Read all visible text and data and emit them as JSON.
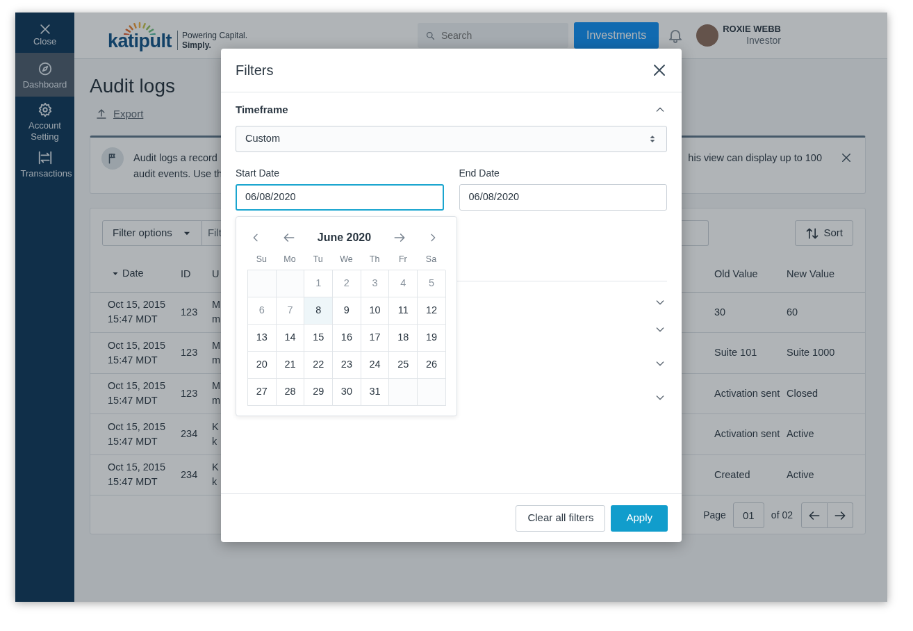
{
  "sidebar": {
    "close_label": "Close",
    "items": [
      {
        "label": "Dashboard",
        "selected": true
      },
      {
        "label": "Account Setting",
        "selected": false
      },
      {
        "label": "Transactions",
        "selected": false
      }
    ]
  },
  "header": {
    "logo": "katipult",
    "tagline": [
      "Powering Capital.",
      "Simply."
    ],
    "search": {
      "placeholder": "Search"
    },
    "primary_button": "Investments",
    "user": {
      "name": "ROXIE WEBB",
      "role": "Investor"
    }
  },
  "page": {
    "title": "Audit logs",
    "export": "Export",
    "notice": {
      "left_lines": [
        "Audit logs a record",
        "audit events. Use th"
      ],
      "right_lines": [
        "his view can display up to 100"
      ]
    },
    "toolbar": {
      "filter_button": "Filter options",
      "filter_field": "Filt",
      "sort": "Sort"
    },
    "table": {
      "columns": [
        {
          "label": "Date",
          "sorted": true
        },
        {
          "label": "ID",
          "sorted": false
        },
        {
          "label": "U",
          "sorted": false
        },
        {
          "label": "Old Value",
          "sorted": false
        },
        {
          "label": "New Value",
          "sorted": false
        }
      ],
      "rows": [
        {
          "date": [
            "Oct 15, 2015",
            "15:47 MDT"
          ],
          "id": "123",
          "column_3": [
            "M",
            "m"
          ],
          "old_value": "30",
          "new_value": "60"
        },
        {
          "date": [
            "Oct 15, 2015",
            "15:47 MDT"
          ],
          "id": "123",
          "column_3": [
            "M",
            "m"
          ],
          "old_value": "Suite 101",
          "new_value": "Suite 1000"
        },
        {
          "date": [
            "Oct 15, 2015",
            "15:47 MDT"
          ],
          "id": "123",
          "column_3": [
            "M",
            "m"
          ],
          "old_value": "Activation sent",
          "new_value": "Closed"
        },
        {
          "date": [
            "Oct 15, 2015",
            "15:47 MDT"
          ],
          "id": "234",
          "column_3": [
            "K",
            "k"
          ],
          "old_value": "Activation sent",
          "new_value": "Active"
        },
        {
          "date": [
            "Oct 15, 2015",
            "15:47 MDT"
          ],
          "id": "234",
          "column_3": [
            "K",
            "k"
          ],
          "old_value": "Created",
          "new_value": "Active"
        }
      ]
    },
    "pagination": {
      "label": "Page",
      "page": "01",
      "total": "of 02"
    }
  },
  "modal": {
    "title": "Filters",
    "timeframe": {
      "title": "Timeframe",
      "expanded": true,
      "select_value": "Custom",
      "start_date": {
        "label": "Start Date",
        "value": "06/08/2020",
        "focused": true
      },
      "end_date": {
        "label": "End Date",
        "value": "06/08/2020",
        "focused": false
      },
      "calendar": {
        "month": "June 2020",
        "weekdays": [
          "Su",
          "Mo",
          "Tu",
          "We",
          "Th",
          "Fr",
          "Sa"
        ],
        "weeks": [
          [
            {
              "blank": true
            },
            {
              "blank": true
            },
            {
              "label": "1",
              "disabled": true,
              "selected": false
            },
            {
              "label": "2",
              "disabled": true,
              "selected": false
            },
            {
              "label": "3",
              "disabled": true,
              "selected": false
            },
            {
              "label": "4",
              "disabled": true,
              "selected": false
            },
            {
              "label": "5",
              "disabled": true,
              "selected": false
            }
          ],
          [
            {
              "label": "6",
              "disabled": true,
              "selected": false
            },
            {
              "label": "7",
              "disabled": true,
              "selected": false
            },
            {
              "label": "8",
              "disabled": false,
              "selected": true
            },
            {
              "label": "9",
              "disabled": false,
              "selected": false
            },
            {
              "label": "10",
              "disabled": false,
              "selected": false
            },
            {
              "label": "11",
              "disabled": false,
              "selected": false
            },
            {
              "label": "12",
              "disabled": false,
              "selected": false
            }
          ],
          [
            {
              "label": "13",
              "disabled": false,
              "selected": false
            },
            {
              "label": "14",
              "disabled": false,
              "selected": false
            },
            {
              "label": "15",
              "disabled": false,
              "selected": false
            },
            {
              "label": "16",
              "disabled": false,
              "selected": false
            },
            {
              "label": "17",
              "disabled": false,
              "selected": false
            },
            {
              "label": "18",
              "disabled": false,
              "selected": false
            },
            {
              "label": "19",
              "disabled": false,
              "selected": false
            }
          ],
          [
            {
              "label": "20",
              "disabled": false,
              "selected": false
            },
            {
              "label": "21",
              "disabled": false,
              "selected": false
            },
            {
              "label": "22",
              "disabled": false,
              "selected": false
            },
            {
              "label": "23",
              "disabled": false,
              "selected": false
            },
            {
              "label": "24",
              "disabled": false,
              "selected": false
            },
            {
              "label": "25",
              "disabled": false,
              "selected": false
            },
            {
              "label": "26",
              "disabled": false,
              "selected": false
            }
          ],
          [
            {
              "label": "27",
              "disabled": false,
              "selected": false
            },
            {
              "label": "28",
              "disabled": false,
              "selected": false
            },
            {
              "label": "29",
              "disabled": false,
              "selected": false
            },
            {
              "label": "30",
              "disabled": false,
              "selected": false
            },
            {
              "label": "31",
              "disabled": false,
              "selected": false
            },
            {
              "blank": true
            },
            {
              "blank": true
            }
          ]
        ]
      }
    },
    "collapsed_sections": [
      {
        "expanded": false
      },
      {
        "expanded": false
      },
      {
        "expanded": false
      },
      {
        "expanded": false
      }
    ],
    "buttons": [
      {
        "label": "Clear all filters",
        "kind": "secondary"
      },
      {
        "label": "Apply",
        "kind": "primary"
      }
    ]
  }
}
